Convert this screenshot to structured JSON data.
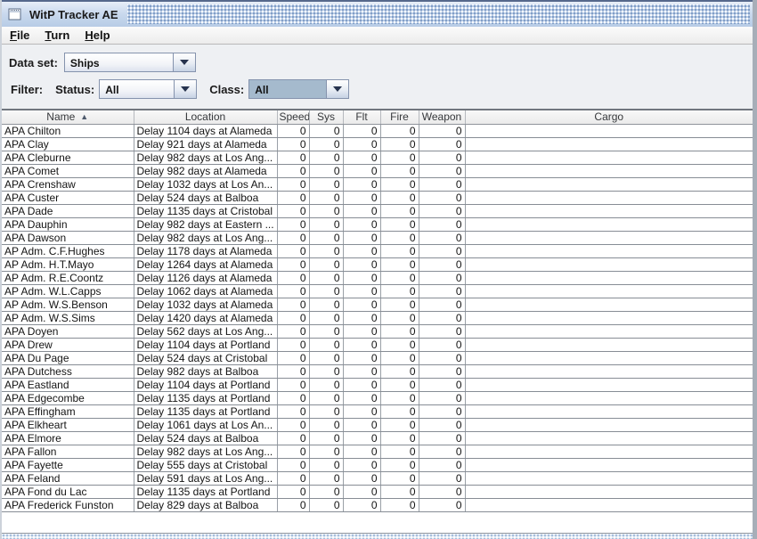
{
  "window": {
    "title": "WitP Tracker AE"
  },
  "menu": {
    "file": {
      "mnemonic": "F",
      "rest": "ile"
    },
    "turn": {
      "mnemonic": "T",
      "rest": "urn"
    },
    "help": {
      "mnemonic": "H",
      "rest": "elp"
    }
  },
  "controls": {
    "data_set_label": "Data set:",
    "data_set_value": "Ships",
    "filter_label": "Filter:",
    "status_label": "Status:",
    "status_value": "All",
    "class_label": "Class:",
    "class_value": "All"
  },
  "table": {
    "sort_indicator": "▲",
    "columns": [
      {
        "label": "Name"
      },
      {
        "label": "Location"
      },
      {
        "label": "Speed"
      },
      {
        "label": "Sys"
      },
      {
        "label": "Flt"
      },
      {
        "label": "Fire"
      },
      {
        "label": "Weapon"
      },
      {
        "label": "Cargo"
      }
    ],
    "rows": [
      {
        "name": "APA Chilton",
        "location": "Delay 1104 days at Alameda",
        "speed": 0,
        "sys": 0,
        "flt": 0,
        "fire": 0,
        "weapon": 0,
        "cargo": ""
      },
      {
        "name": "APA Clay",
        "location": "Delay 921 days at Alameda",
        "speed": 0,
        "sys": 0,
        "flt": 0,
        "fire": 0,
        "weapon": 0,
        "cargo": ""
      },
      {
        "name": "APA Cleburne",
        "location": "Delay 982 days at Los Ang...",
        "speed": 0,
        "sys": 0,
        "flt": 0,
        "fire": 0,
        "weapon": 0,
        "cargo": ""
      },
      {
        "name": "APA Comet",
        "location": "Delay 982 days at Alameda",
        "speed": 0,
        "sys": 0,
        "flt": 0,
        "fire": 0,
        "weapon": 0,
        "cargo": ""
      },
      {
        "name": "APA Crenshaw",
        "location": "Delay 1032 days at Los An...",
        "speed": 0,
        "sys": 0,
        "flt": 0,
        "fire": 0,
        "weapon": 0,
        "cargo": ""
      },
      {
        "name": "APA Custer",
        "location": "Delay 524 days at Balboa",
        "speed": 0,
        "sys": 0,
        "flt": 0,
        "fire": 0,
        "weapon": 0,
        "cargo": ""
      },
      {
        "name": "APA Dade",
        "location": "Delay 1135 days at Cristobal",
        "speed": 0,
        "sys": 0,
        "flt": 0,
        "fire": 0,
        "weapon": 0,
        "cargo": ""
      },
      {
        "name": "APA Dauphin",
        "location": "Delay 982 days at Eastern ...",
        "speed": 0,
        "sys": 0,
        "flt": 0,
        "fire": 0,
        "weapon": 0,
        "cargo": ""
      },
      {
        "name": "APA Dawson",
        "location": "Delay 982 days at Los Ang...",
        "speed": 0,
        "sys": 0,
        "flt": 0,
        "fire": 0,
        "weapon": 0,
        "cargo": ""
      },
      {
        "name": "AP Adm. C.F.Hughes",
        "location": "Delay 1178 days at Alameda",
        "speed": 0,
        "sys": 0,
        "flt": 0,
        "fire": 0,
        "weapon": 0,
        "cargo": ""
      },
      {
        "name": "AP Adm. H.T.Mayo",
        "location": "Delay 1264 days at Alameda",
        "speed": 0,
        "sys": 0,
        "flt": 0,
        "fire": 0,
        "weapon": 0,
        "cargo": ""
      },
      {
        "name": "AP Adm. R.E.Coontz",
        "location": "Delay 1126 days at Alameda",
        "speed": 0,
        "sys": 0,
        "flt": 0,
        "fire": 0,
        "weapon": 0,
        "cargo": ""
      },
      {
        "name": "AP Adm. W.L.Capps",
        "location": "Delay 1062 days at Alameda",
        "speed": 0,
        "sys": 0,
        "flt": 0,
        "fire": 0,
        "weapon": 0,
        "cargo": ""
      },
      {
        "name": "AP Adm. W.S.Benson",
        "location": "Delay 1032 days at Alameda",
        "speed": 0,
        "sys": 0,
        "flt": 0,
        "fire": 0,
        "weapon": 0,
        "cargo": ""
      },
      {
        "name": "AP Adm. W.S.Sims",
        "location": "Delay 1420 days at Alameda",
        "speed": 0,
        "sys": 0,
        "flt": 0,
        "fire": 0,
        "weapon": 0,
        "cargo": ""
      },
      {
        "name": "APA Doyen",
        "location": "Delay 562 days at Los Ang...",
        "speed": 0,
        "sys": 0,
        "flt": 0,
        "fire": 0,
        "weapon": 0,
        "cargo": ""
      },
      {
        "name": "APA Drew",
        "location": "Delay 1104 days at Portland",
        "speed": 0,
        "sys": 0,
        "flt": 0,
        "fire": 0,
        "weapon": 0,
        "cargo": ""
      },
      {
        "name": "APA Du Page",
        "location": "Delay 524 days at Cristobal",
        "speed": 0,
        "sys": 0,
        "flt": 0,
        "fire": 0,
        "weapon": 0,
        "cargo": ""
      },
      {
        "name": "APA Dutchess",
        "location": "Delay 982 days at Balboa",
        "speed": 0,
        "sys": 0,
        "flt": 0,
        "fire": 0,
        "weapon": 0,
        "cargo": ""
      },
      {
        "name": "APA Eastland",
        "location": "Delay 1104 days at Portland",
        "speed": 0,
        "sys": 0,
        "flt": 0,
        "fire": 0,
        "weapon": 0,
        "cargo": ""
      },
      {
        "name": "APA Edgecombe",
        "location": "Delay 1135 days at Portland",
        "speed": 0,
        "sys": 0,
        "flt": 0,
        "fire": 0,
        "weapon": 0,
        "cargo": ""
      },
      {
        "name": "APA Effingham",
        "location": "Delay 1135 days at Portland",
        "speed": 0,
        "sys": 0,
        "flt": 0,
        "fire": 0,
        "weapon": 0,
        "cargo": ""
      },
      {
        "name": "APA Elkheart",
        "location": "Delay 1061 days at Los An...",
        "speed": 0,
        "sys": 0,
        "flt": 0,
        "fire": 0,
        "weapon": 0,
        "cargo": ""
      },
      {
        "name": "APA Elmore",
        "location": "Delay 524 days at Balboa",
        "speed": 0,
        "sys": 0,
        "flt": 0,
        "fire": 0,
        "weapon": 0,
        "cargo": ""
      },
      {
        "name": "APA Fallon",
        "location": "Delay 982 days at Los Ang...",
        "speed": 0,
        "sys": 0,
        "flt": 0,
        "fire": 0,
        "weapon": 0,
        "cargo": ""
      },
      {
        "name": "APA Fayette",
        "location": "Delay 555 days at Cristobal",
        "speed": 0,
        "sys": 0,
        "flt": 0,
        "fire": 0,
        "weapon": 0,
        "cargo": ""
      },
      {
        "name": "APA Feland",
        "location": "Delay 591 days at Los Ang...",
        "speed": 0,
        "sys": 0,
        "flt": 0,
        "fire": 0,
        "weapon": 0,
        "cargo": ""
      },
      {
        "name": "APA Fond du Lac",
        "location": "Delay 1135 days at Portland",
        "speed": 0,
        "sys": 0,
        "flt": 0,
        "fire": 0,
        "weapon": 0,
        "cargo": ""
      },
      {
        "name": "APA Frederick Funston",
        "location": "Delay 829 days at Balboa",
        "speed": 0,
        "sys": 0,
        "flt": 0,
        "fire": 0,
        "weapon": 0,
        "cargo": ""
      }
    ]
  },
  "colors": {
    "titlebar_base": "#b9cde8",
    "titlebar_dot": "#7f9cc4",
    "selected_combo_bg": "#a5bacd",
    "grid_line": "#878d95",
    "panel_bg": "#eef0f3"
  }
}
